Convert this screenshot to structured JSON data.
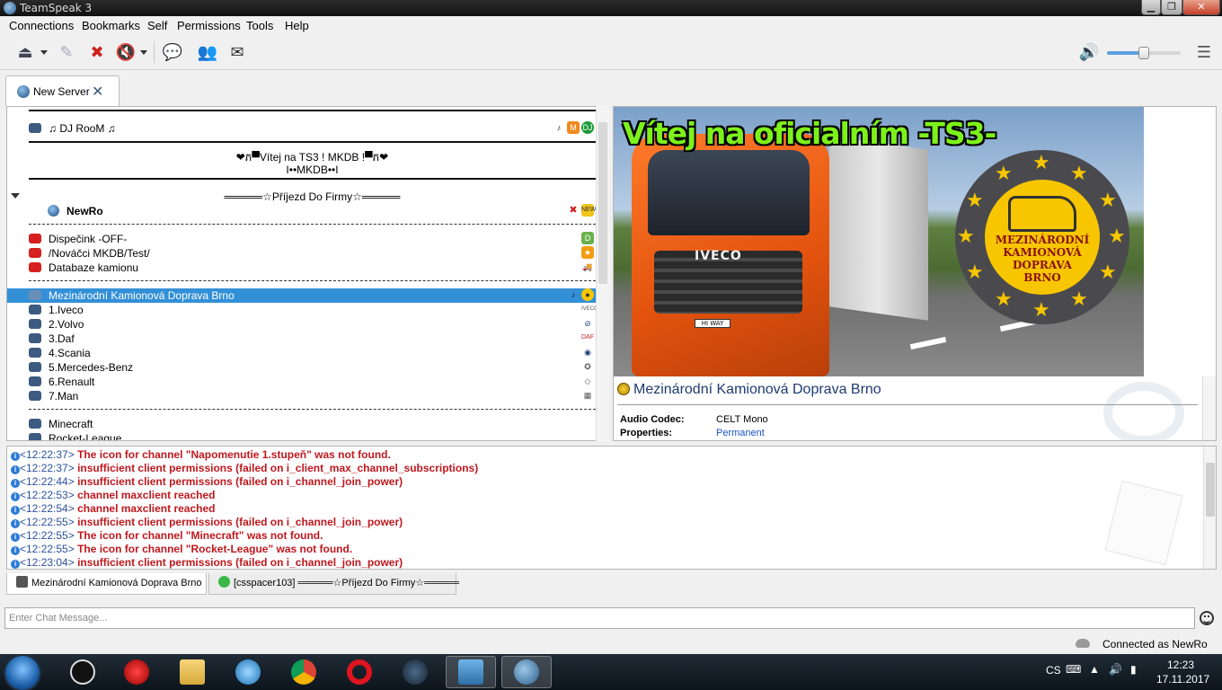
{
  "window": {
    "title": "TeamSpeak 3"
  },
  "menu": [
    "Connections",
    "Bookmarks",
    "Self",
    "Permissions",
    "Tools",
    "Help"
  ],
  "server_tab": {
    "label": "New Server"
  },
  "tree": {
    "dj_room": "♫ DJ RooM ♫",
    "welcome_line1": "❤ភ▀Vítej na TS3 ! MKDB !▀ភ❤",
    "welcome_line2": "I••MKDB••I",
    "spacer_prijezd": "═════☆Příjezd Do Firmy☆═════",
    "user": "NewRo",
    "group1": [
      "Dispečink -OFF-",
      "/Nováčci MKDB/Test/",
      "Databaze kamionu"
    ],
    "selected_channel": "Mezinárodní Kamionová Doprava Brno",
    "brands": [
      "1.Iveco",
      "2.Volvo",
      "3.Daf",
      "4.Scania",
      "5.Mercedes-Benz",
      "6.Renault",
      "7.Man"
    ],
    "group3": [
      "Minecraft",
      "Rocket-League"
    ]
  },
  "info": {
    "banner_title": "Vítej na oficialním -TS3-",
    "truck_brand": "IVECO",
    "truck_plate": "HI WAY",
    "emblem_text": [
      "MEZINÁRODNÍ",
      "KAMIONOVÁ",
      "DOPRAVA",
      "BRNO"
    ],
    "channel_name": "Mezinárodní Kamionová Doprava Brno",
    "audio_codec_label": "Audio Codec:",
    "audio_codec_value": "CELT Mono",
    "properties_label": "Properties:",
    "properties_value": "Permanent"
  },
  "log": [
    {
      "time": "<12:22:37>",
      "msg": "The icon for channel \"Napomenutie 1.stupeň\" was not found."
    },
    {
      "time": "<12:22:37>",
      "msg": "insufficient client permissions (failed on i_client_max_channel_subscriptions)"
    },
    {
      "time": "<12:22:44>",
      "msg": "insufficient client permissions (failed on i_channel_join_power)"
    },
    {
      "time": "<12:22:53>",
      "msg": "channel maxclient reached"
    },
    {
      "time": "<12:22:54>",
      "msg": "channel maxclient reached"
    },
    {
      "time": "<12:22:55>",
      "msg": "insufficient client permissions (failed on i_channel_join_power)"
    },
    {
      "time": "<12:22:55>",
      "msg": "The icon for channel \"Minecraft\" was not found."
    },
    {
      "time": "<12:22:55>",
      "msg": "The icon for channel \"Rocket-League\" was not found."
    },
    {
      "time": "<12:23:04>",
      "msg": "insufficient client permissions (failed on i_channel_join_power)"
    }
  ],
  "chat_tabs": [
    "Mezinárodní Kamionová Doprava Brno",
    "[csspacer103] ═════☆Příjezd Do Firmy☆═════"
  ],
  "chat_input": {
    "placeholder": "Enter Chat Message..."
  },
  "status": {
    "connected": "Connected as NewRo"
  },
  "taskbar": {
    "lang": "CS",
    "time": "12:23",
    "date": "17.11.2017"
  },
  "volume": {
    "level": 0.5
  }
}
